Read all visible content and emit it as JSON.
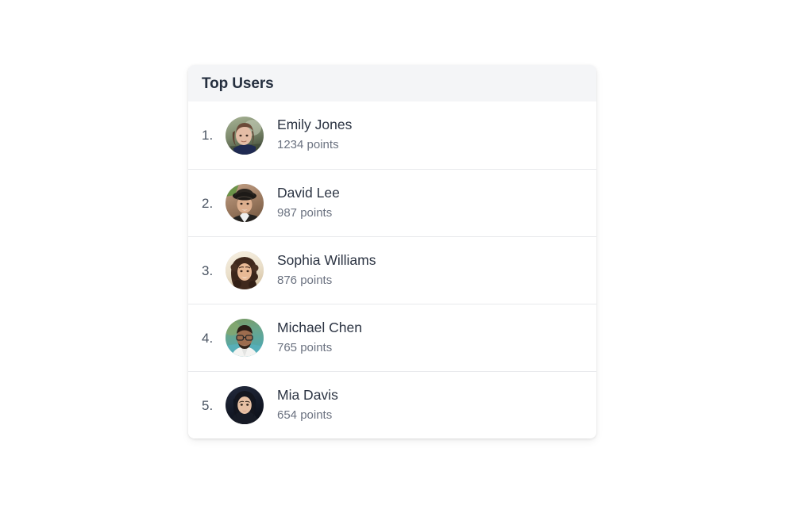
{
  "page": {
    "background_color": "#ffffff"
  },
  "card": {
    "header": {
      "title": "Top Users",
      "background_color": "#f4f5f7",
      "title_color": "#252f3f"
    },
    "border_radius_px": 8,
    "divider_color": "#e8e9ec",
    "background_color": "#ffffff"
  },
  "users": [
    {
      "rank": "1.",
      "name": "Emily Jones",
      "points": "1234 points",
      "avatar": {
        "icon": "avatar-photo-emily-jones",
        "alt": "Young woman with brown hair wearing a dark navy top, blurred green outdoor background",
        "bg_top": "#9aa88c",
        "bg_bottom": "#55604d",
        "skin": "#e4bda6",
        "hair": "#6b4a38",
        "clothing": "#1f2a52"
      }
    },
    {
      "rank": "2.",
      "name": "David Lee",
      "points": "987 points",
      "avatar": {
        "icon": "avatar-photo-david-lee",
        "alt": "Smiling man wearing a black fedora hat, warm brown background with green patch",
        "bg_top": "#b49279",
        "bg_bottom": "#8e6f58",
        "skin": "#dcae8d",
        "hair": "#2a2118",
        "clothing": "#23211f"
      }
    },
    {
      "rank": "3.",
      "name": "Sophia Williams",
      "points": "876 points",
      "avatar": {
        "icon": "avatar-photo-sophia-williams",
        "alt": "Smiling woman with long curly dark hair on a light cream background",
        "bg_top": "#f3ead9",
        "bg_bottom": "#e2d4bd",
        "skin": "#e8b995",
        "hair": "#40291d",
        "clothing": "#3d2a20"
      }
    },
    {
      "rank": "4.",
      "name": "Michael Chen",
      "points": "765 points",
      "avatar": {
        "icon": "avatar-photo-michael-chen",
        "alt": "Bald man with glasses and a beard wearing a white shirt, tropical teal background",
        "bg_top": "#6f8f5e",
        "bg_bottom": "#4fa6ae",
        "skin": "#9c6c4e",
        "hair": "#2b1d16",
        "clothing": "#f4f4f2"
      }
    },
    {
      "rank": "5.",
      "name": "Mia Davis",
      "points": "654 points",
      "avatar": {
        "icon": "avatar-photo-mia-davis",
        "alt": "Woman with long dark hair in a dark hoodie against a very dark background",
        "bg_top": "#1b2133",
        "bg_bottom": "#10141f",
        "skin": "#e7c0a4",
        "hair": "#14161f",
        "clothing": "#171b26"
      }
    }
  ]
}
